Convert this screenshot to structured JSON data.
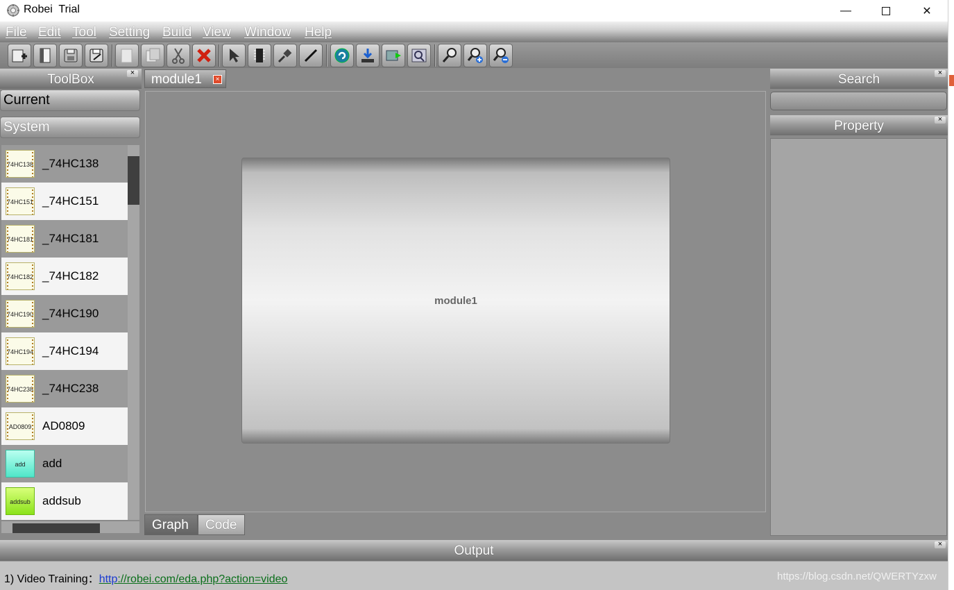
{
  "window": {
    "title": "Robei  Trial",
    "minimize": "—",
    "close": "✕"
  },
  "menu": [
    "File",
    "Edit",
    "Tool",
    "Setting",
    "Build",
    "View",
    "Window",
    "Help"
  ],
  "toolbar": {
    "buttons": [
      "new-module-icon",
      "open-icon",
      "save-icon",
      "save-as-icon",
      "copy-icon",
      "paste-icon",
      "cut-icon",
      "delete-icon",
      "select-pointer-icon",
      "module-chip-icon",
      "connect-pin-icon",
      "wire-icon",
      "simulate-icon",
      "download-icon",
      "run-sim-icon",
      "waveform-zoom-icon",
      "zoom-icon",
      "zoom-in-icon",
      "zoom-out-icon"
    ]
  },
  "toolbox": {
    "title": "ToolBox",
    "close": "×",
    "sections": {
      "current": "Current",
      "system": "System"
    },
    "components": [
      {
        "chip": "74HC138",
        "label": "_74HC138",
        "style": "chip"
      },
      {
        "chip": "74HC151",
        "label": "_74HC151",
        "style": "chip"
      },
      {
        "chip": "74HC181",
        "label": "_74HC181",
        "style": "chip"
      },
      {
        "chip": "74HC182",
        "label": "_74HC182",
        "style": "chip"
      },
      {
        "chip": "74HC190",
        "label": "_74HC190",
        "style": "chip"
      },
      {
        "chip": "74HC194",
        "label": "_74HC194",
        "style": "chip"
      },
      {
        "chip": "74HC238",
        "label": "_74HC238",
        "style": "chip"
      },
      {
        "chip": "AD0809",
        "label": "AD0809",
        "style": "chip"
      },
      {
        "chip": "add",
        "label": "add",
        "style": "teal"
      },
      {
        "chip": "addsub",
        "label": "addsub",
        "style": "lime"
      }
    ]
  },
  "editor": {
    "tab": "module1",
    "tab_close": "×",
    "module_name": "module1",
    "bottom_tabs": {
      "graph": "Graph",
      "code": "Code"
    }
  },
  "right": {
    "search_title": "Search",
    "property_title": "Property",
    "close": "×"
  },
  "output": {
    "title": "Output",
    "close": "×",
    "line_prefix": "1) Video Training：",
    "link_proto": "http",
    "link_rest": "://robei.com/eda.php?action=video",
    "watermark": "https://blog.csdn.net/QWERTYzxw"
  },
  "colors": {
    "tab_close": "#e04a2a",
    "link": "#0a6e1a",
    "teal_chip": "#4fe6c8",
    "lime_chip": "#8be21a"
  }
}
